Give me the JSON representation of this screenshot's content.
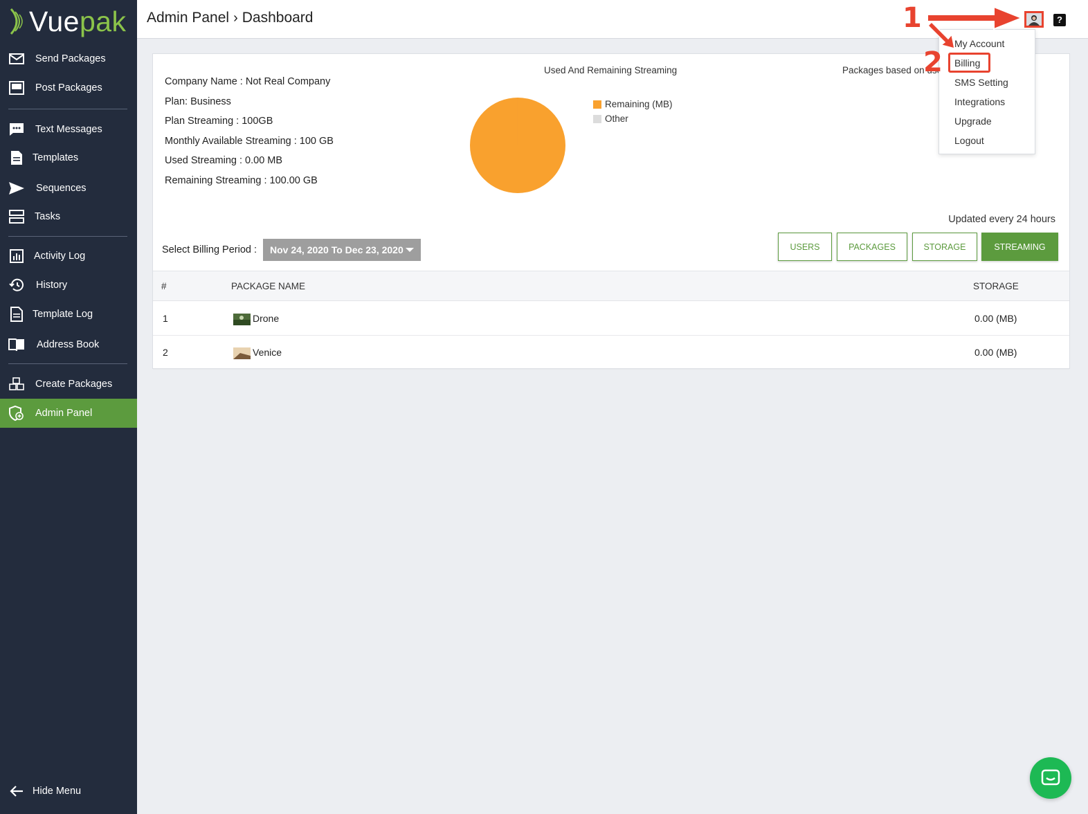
{
  "app": {
    "logo_part1": "Vue",
    "logo_part2": "pak"
  },
  "sidebar": {
    "items": [
      {
        "label": "Send Packages",
        "icon": "envelope-icon"
      },
      {
        "label": "Post Packages",
        "icon": "monitor-icon"
      },
      {
        "label": "Text Messages",
        "icon": "chat-bubble-icon"
      },
      {
        "label": "Templates",
        "icon": "document-icon"
      },
      {
        "label": "Sequences",
        "icon": "paper-plane-icon"
      },
      {
        "label": "Tasks",
        "icon": "tasks-icon"
      },
      {
        "label": "Activity Log",
        "icon": "bar-chart-icon"
      },
      {
        "label": "History",
        "icon": "history-icon"
      },
      {
        "label": "Template Log",
        "icon": "document-icon"
      },
      {
        "label": "Address Book",
        "icon": "book-icon"
      },
      {
        "label": "Create Packages",
        "icon": "boxes-icon"
      },
      {
        "label": "Admin Panel",
        "icon": "admin-icon",
        "active": true
      }
    ],
    "hide_menu": "Hide Menu"
  },
  "header": {
    "crumb_parent": "Admin Panel",
    "crumb_current": "Dashboard",
    "help": "?"
  },
  "dropdown": {
    "items": [
      "My Account",
      "Billing",
      "SMS Setting",
      "Integrations",
      "Upgrade",
      "Logout"
    ]
  },
  "annotations": {
    "step1": "1",
    "step2": "2"
  },
  "company": {
    "lines": [
      "Company Name : Not Real Company",
      "Plan: Business",
      "Plan Streaming : 100GB",
      "Monthly Available Streaming : 100 GB",
      "Used Streaming : 0.00 MB",
      "Remaining Streaming : 100.00 GB"
    ]
  },
  "chart_data": {
    "type": "pie",
    "title": "Used And Remaining Streaming",
    "series": [
      {
        "name": "Remaining (MB)",
        "value": 100,
        "color": "#f9a12e"
      },
      {
        "name": "Other",
        "value": 0,
        "color": "#dcdcdc"
      }
    ]
  },
  "second_chart_title": "Packages based on use",
  "updated_note": "Updated every 24 hours",
  "billing": {
    "label": "Select Billing Period :",
    "selected": "Nov 24, 2020 To Dec 23, 2020"
  },
  "tabs": [
    {
      "label": "USERS",
      "active": false
    },
    {
      "label": "PACKAGES",
      "active": false
    },
    {
      "label": "STORAGE",
      "active": false
    },
    {
      "label": "STREAMING",
      "active": true
    }
  ],
  "table": {
    "headers": [
      "#",
      "PACKAGE NAME",
      "STORAGE"
    ],
    "rows": [
      {
        "index": "1",
        "name": "Drone",
        "storage": "0.00 (MB)"
      },
      {
        "index": "2",
        "name": "Venice",
        "storage": "0.00 (MB)"
      }
    ]
  },
  "colors": {
    "sidebar": "#232c3d",
    "accent": "#5c9b3e",
    "annotation": "#e8432f",
    "chat": "#1db954"
  }
}
